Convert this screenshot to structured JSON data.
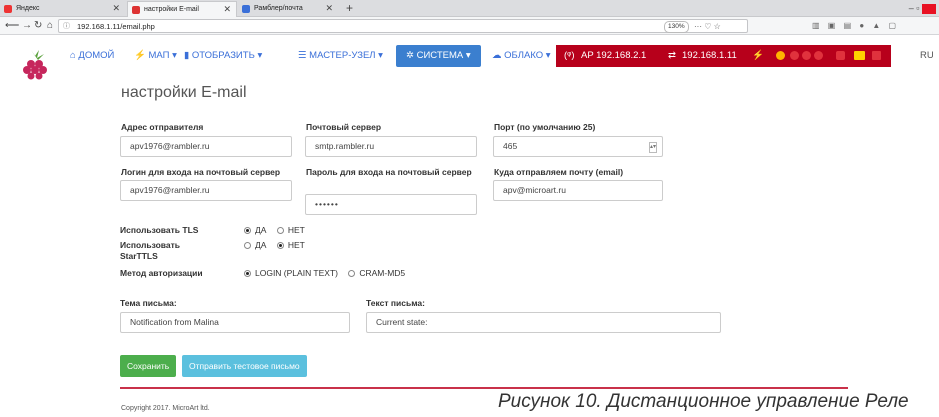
{
  "browser": {
    "tabs": [
      {
        "label": "Яндекс"
      },
      {
        "label": "настройки E-mail"
      },
      {
        "label": "Рамблер/почта"
      }
    ],
    "url": "192.168.1.11/email.php",
    "zoom": "130%",
    "url_actions": "··· ♡ ☆"
  },
  "nav": {
    "home": "ДОМОЙ",
    "map": "МАП ▾",
    "display": "ОТОБРАЗИТЬ ▾",
    "master": "МАСТЕР-УЗЕЛ ▾",
    "system": "СИСТЕМА ▾",
    "cloud": "ОБЛАКО ▾",
    "ap": "AP 192.168.2.1",
    "ip": "192.168.1.11",
    "lang": "RU"
  },
  "page": {
    "title": "настройки E-mail",
    "sender_label": "Адрес отправителя",
    "sender_value": "apv1976@rambler.ru",
    "server_label": "Почтовый сервер",
    "server_value": "smtp.rambler.ru",
    "port_label": "Порт (по умолчанию 25)",
    "port_value": "465",
    "login_label": "Логин для входа на почтовый сервер",
    "login_value": "apv1976@rambler.ru",
    "password_label": "Пароль для входа на почтовый сервер",
    "password_value": "••••••",
    "recipient_label": "Куда отправляем почту (email)",
    "recipient_value": "apv@microart.ru",
    "tls_label": "Использовать TLS",
    "starttls_label": "Использовать StarTTLS",
    "auth_label": "Метод авторизации",
    "yes": "ДА",
    "no": "НЕТ",
    "auth_login": "LOGIN (PLAIN TEXT)",
    "auth_cram": "CRAM-MD5",
    "subject_label": "Тема письма:",
    "subject_value": "Notification from Malina",
    "body_label": "Текст письма:",
    "body_value": "Current state:",
    "save_button": "Сохранить",
    "test_button": "Отправить тестовое письмо",
    "copyright": "Copyright 2017. MicroArt ltd.",
    "caption": "Рисунок 10. Дистанционное управление Реле"
  },
  "state": {
    "tls": "yes",
    "starttls": "no",
    "auth": "login"
  },
  "colors": {
    "accent": "#3b7fcf",
    "status_bar": "#b7001b",
    "save": "#4cae4c",
    "test": "#5bc0de"
  }
}
